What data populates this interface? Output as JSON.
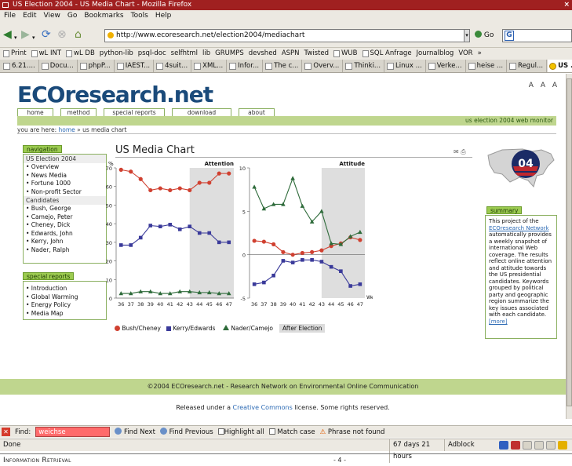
{
  "window": {
    "title": "US Election 2004 - US Media Chart - Mozilla Firefox",
    "close": "×"
  },
  "menu": [
    "File",
    "Edit",
    "View",
    "Go",
    "Bookmarks",
    "Tools",
    "Help"
  ],
  "nav": {
    "url": "http://www.ecoresearch.net/election2004/mediachart",
    "go": "Go",
    "search_glyph": "G"
  },
  "bookmarks": [
    "Print",
    "wL INT",
    "wL DB",
    "python-lib",
    "psql-doc",
    "selfhtml",
    "lib",
    "GRUMPS",
    "devshed",
    "ASPN",
    "Twisted",
    "WUB",
    "SQL Anfrage",
    "Journalblog",
    "VOR",
    "»"
  ],
  "tabs": [
    "6.21....",
    "Docu...",
    "phpP...",
    "IAEST...",
    "4suit...",
    "XML...",
    "Infor...",
    "The c...",
    "Overv...",
    "Thinki...",
    "Linux ...",
    "Verke...",
    "heise ...",
    "Regul...",
    "US ..."
  ],
  "site": {
    "logo": "ECOresearch.net",
    "font_sizes": "A A A",
    "top_tabs": [
      "home",
      "method",
      "special reports",
      "download",
      "about"
    ],
    "monitor_label": "us election 2004 web monitor",
    "breadcrumb_prefix": "you are here: ",
    "breadcrumb_home": "home",
    "breadcrumb_sep": " » ",
    "breadcrumb_current": "us media chart",
    "navigation_title": "navigation",
    "nav_group1": "US Election 2004",
    "nav_items1": [
      "• Overview",
      "• News Media",
      "• Fortune 1000",
      "• Non-profit Sector"
    ],
    "nav_group2": "Candidates",
    "nav_items2": [
      "• Bush, George",
      "• Camejo, Peter",
      "• Cheney, Dick",
      "• Edwards, John",
      "• Kerry, John",
      "• Nader, Ralph"
    ],
    "special_title": "special reports",
    "special_items": [
      "• Introduction",
      "• Global Warming",
      "• Energy Policy",
      "• Media Map"
    ],
    "page_title": "US Media Chart",
    "summary_title": "summary",
    "summary_pre": "This project of the ",
    "summary_link": "ECOresearch Network",
    "summary_post": " automatically provides a weekly snapshot of international Web coverage. The results reflect online attention and attitude towards the US presidential candidates. Keywords grouped by political party and geographic region summarize the key issues associated with each candidate.",
    "summary_more": "[more]",
    "footer": "©2004 ECOresearch.net - Research Network on Environmental Online Communication",
    "license_pre": "Released under a ",
    "license_link": "Creative Commons",
    "license_post": " license. Some rights reserved.",
    "badge": "04"
  },
  "chart_data": [
    {
      "type": "line",
      "title": "Attention",
      "ylabel": "%",
      "x": [
        36,
        37,
        38,
        39,
        40,
        41,
        42,
        43,
        44,
        45,
        46,
        47
      ],
      "ylim": [
        0,
        70
      ],
      "yticks": [
        0,
        10,
        20,
        30,
        40,
        50,
        60,
        70
      ],
      "shaded_from": 43,
      "series": [
        {
          "name": "Bush/Cheney",
          "color": "#d04030",
          "marker": "circle",
          "values": [
            69,
            68,
            64,
            58,
            59,
            58,
            59,
            58,
            62,
            62,
            67,
            67
          ]
        },
        {
          "name": "Kerry/Edwards",
          "color": "#3a3a9a",
          "marker": "square",
          "values": [
            28.5,
            28.5,
            32.5,
            39,
            38.5,
            39.5,
            37,
            38.5,
            35,
            35,
            30,
            30
          ]
        },
        {
          "name": "Nader/Camejo",
          "color": "#2e6b3a",
          "marker": "triangle",
          "values": [
            2.5,
            2.5,
            3.5,
            3.5,
            2.5,
            2.5,
            3.5,
            3.5,
            3,
            3,
            2.5,
            2.5
          ]
        }
      ]
    },
    {
      "type": "line",
      "title": "Attitude",
      "xlabel": "Week",
      "x": [
        36,
        37,
        38,
        39,
        40,
        41,
        42,
        43,
        44,
        45,
        46,
        47
      ],
      "ylim": [
        -5,
        10
      ],
      "yticks": [
        -5,
        0,
        5,
        10
      ],
      "shaded_from": 43,
      "series": [
        {
          "name": "Bush/Cheney",
          "color": "#d04030",
          "marker": "circle",
          "values": [
            1.6,
            1.5,
            1.2,
            0.3,
            0,
            0.2,
            0.3,
            0.5,
            1,
            1.3,
            2,
            1.7
          ]
        },
        {
          "name": "Kerry/Edwards",
          "color": "#3a3a9a",
          "marker": "square",
          "values": [
            -3.4,
            -3.2,
            -2.4,
            -0.7,
            -0.9,
            -0.6,
            -0.6,
            -0.8,
            -1.4,
            -1.9,
            -3.6,
            -3.4
          ]
        },
        {
          "name": "Nader/Camejo",
          "color": "#2e6b3a",
          "marker": "triangle",
          "values": [
            7.8,
            5.3,
            5.8,
            5.8,
            8.8,
            5.6,
            3.8,
            5,
            1.3,
            1.2,
            2.1,
            2.6
          ]
        }
      ]
    }
  ],
  "legend": {
    "after_election": "After Election"
  },
  "findbar": {
    "label": "Find:",
    "value": "weichse",
    "next": "Find Next",
    "previous": "Find Previous",
    "highlight": "Highlight all",
    "match_case": "Match case",
    "warning": "Phrase not found"
  },
  "status": {
    "done": "Done",
    "timer": "67 days 21 hours",
    "adblock": "Adblock"
  },
  "doc_footer": {
    "left": "Information Retrieval",
    "center": "- 4 -"
  }
}
